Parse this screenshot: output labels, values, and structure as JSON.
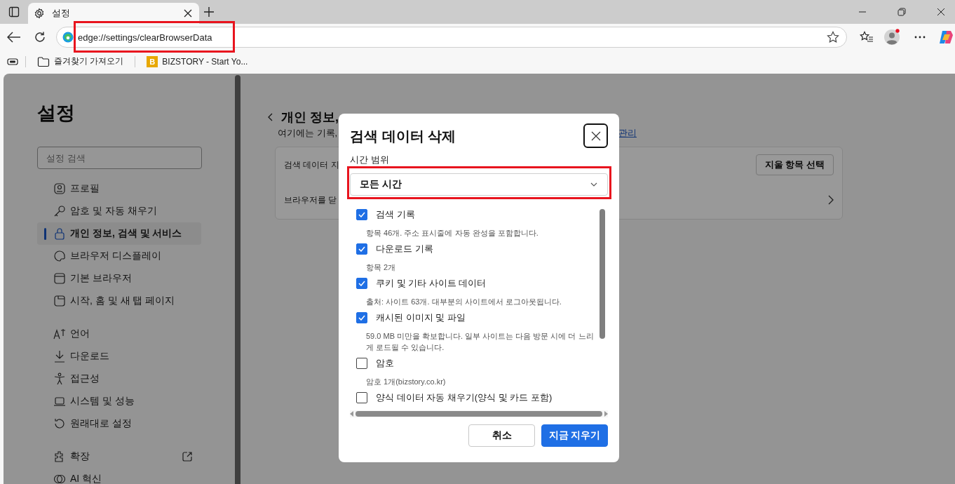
{
  "tabs": [
    {
      "title": "설정",
      "selected": true
    }
  ],
  "address_bar": {
    "url": "edge://settings/clearBrowserData",
    "highlighted": true
  },
  "bookmarks": [
    {
      "kind": "folder",
      "label": "즐겨찾기 가져오기"
    },
    {
      "kind": "site",
      "label": "BIZSTORY - Start Yo...",
      "favicon_letter": "B"
    }
  ],
  "sidebar": {
    "title": "설정",
    "search_placeholder": "설정 검색",
    "groups": [
      [
        {
          "label": "프로필",
          "selected": false
        },
        {
          "label": "암호 및 자동 채우기",
          "selected": false
        },
        {
          "label": "개인 정보, 검색 및 서비스",
          "selected": true
        },
        {
          "label": "브라우저 디스플레이",
          "selected": false
        },
        {
          "label": "기본 브라우저",
          "selected": false
        },
        {
          "label": "시작, 홈 및 새 탭 페이지",
          "selected": false
        }
      ],
      [
        {
          "label": "언어",
          "selected": false
        },
        {
          "label": "다운로드",
          "selected": false
        },
        {
          "label": "접근성",
          "selected": false
        },
        {
          "label": "시스템 및 성능",
          "selected": false
        },
        {
          "label": "원래대로 설정",
          "selected": false
        }
      ],
      [
        {
          "label": "확장",
          "selected": false,
          "external": true
        },
        {
          "label": "AI 혁신",
          "selected": false
        }
      ]
    ]
  },
  "page": {
    "heading": "개인 정보,",
    "subtitle": "여기에는 기록,",
    "subtitle_link": "관리",
    "rows": [
      {
        "label": "검색 데이터 지",
        "button": "지울 항목 선택"
      },
      {
        "label": "브라우저를 닫",
        "chevron": true
      }
    ]
  },
  "dialog": {
    "title": "검색 데이터 삭제",
    "time_range_label": "시간 범위",
    "time_range": {
      "value": "모든 시간",
      "highlighted": true
    },
    "items": [
      {
        "label": "검색 기록",
        "checked": true,
        "detail": "항목 46개. 주소 표시줄에 자동 완성을 포함합니다."
      },
      {
        "label": "다운로드 기록",
        "checked": true,
        "detail": "항목 2개"
      },
      {
        "label": "쿠키 및 기타 사이트 데이터",
        "checked": true,
        "detail": "출처: 사이트 63개. 대부분의 사이트에서 로그아웃됩니다."
      },
      {
        "label": "캐시된 이미지 및 파일",
        "checked": true,
        "detail": "59.0 MB 미만을 확보합니다. 일부 사이트는 다음 방문 시에 더 느리게 로드될 수 있습니다."
      },
      {
        "label": "암호",
        "checked": false,
        "detail": "암호 1개(bizstory.co.kr)"
      },
      {
        "label": "양식 데이터 자동 채우기(양식 및 카드 포함)",
        "checked": false
      }
    ],
    "buttons": [
      {
        "label": "취소",
        "kind": "secondary"
      },
      {
        "label": "지금 지우기",
        "kind": "primary"
      }
    ]
  }
}
